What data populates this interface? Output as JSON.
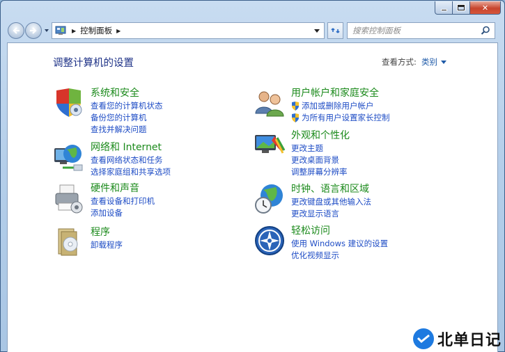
{
  "window": {
    "title_buttons": [
      "minimize",
      "maximize",
      "close"
    ],
    "close_glyph": "✕"
  },
  "nav": {
    "back_icon": "back-arrow-icon",
    "forward_icon": "forward-arrow-icon",
    "breadcrumb": [
      "控制面板"
    ],
    "search_placeholder": "搜索控制面板"
  },
  "header": {
    "title": "调整计算机的设置",
    "view_by_label": "查看方式:",
    "view_by_value": "类别"
  },
  "categories": [
    {
      "icon": "shield-security-icon",
      "title": "系统和安全",
      "links": [
        "查看您的计算机状态",
        "备份您的计算机",
        "查找并解决问题"
      ]
    },
    {
      "icon": "network-globe-icon",
      "title": "网络和 Internet",
      "links": [
        "查看网络状态和任务",
        "选择家庭组和共享选项"
      ]
    },
    {
      "icon": "printer-hardware-icon",
      "title": "硬件和声音",
      "links": [
        "查看设备和打印机",
        "添加设备"
      ]
    },
    {
      "icon": "programs-icon",
      "title": "程序",
      "links": [
        "卸载程序"
      ]
    },
    {
      "icon": "user-accounts-icon",
      "title": "用户帐户和家庭安全",
      "links": [
        "添加或删除用户帐户",
        "为所有用户设置家长控制"
      ]
    },
    {
      "icon": "appearance-icon",
      "title": "外观和个性化",
      "links": [
        "更改主题",
        "更改桌面背景",
        "调整屏幕分辨率"
      ]
    },
    {
      "icon": "clock-globe-icon",
      "title": "时钟、语言和区域",
      "links": [
        "更改键盘或其他输入法",
        "更改显示语言"
      ]
    },
    {
      "icon": "ease-of-access-icon",
      "title": "轻松访问",
      "links": [
        "使用 Windows 建议的设置",
        "优化视频显示"
      ]
    }
  ],
  "watermark": {
    "text": "北单日记"
  },
  "colors": {
    "title_blue": "#1e3287",
    "category_green": "#1b8a1b",
    "link_blue": "#1e4cc5"
  }
}
